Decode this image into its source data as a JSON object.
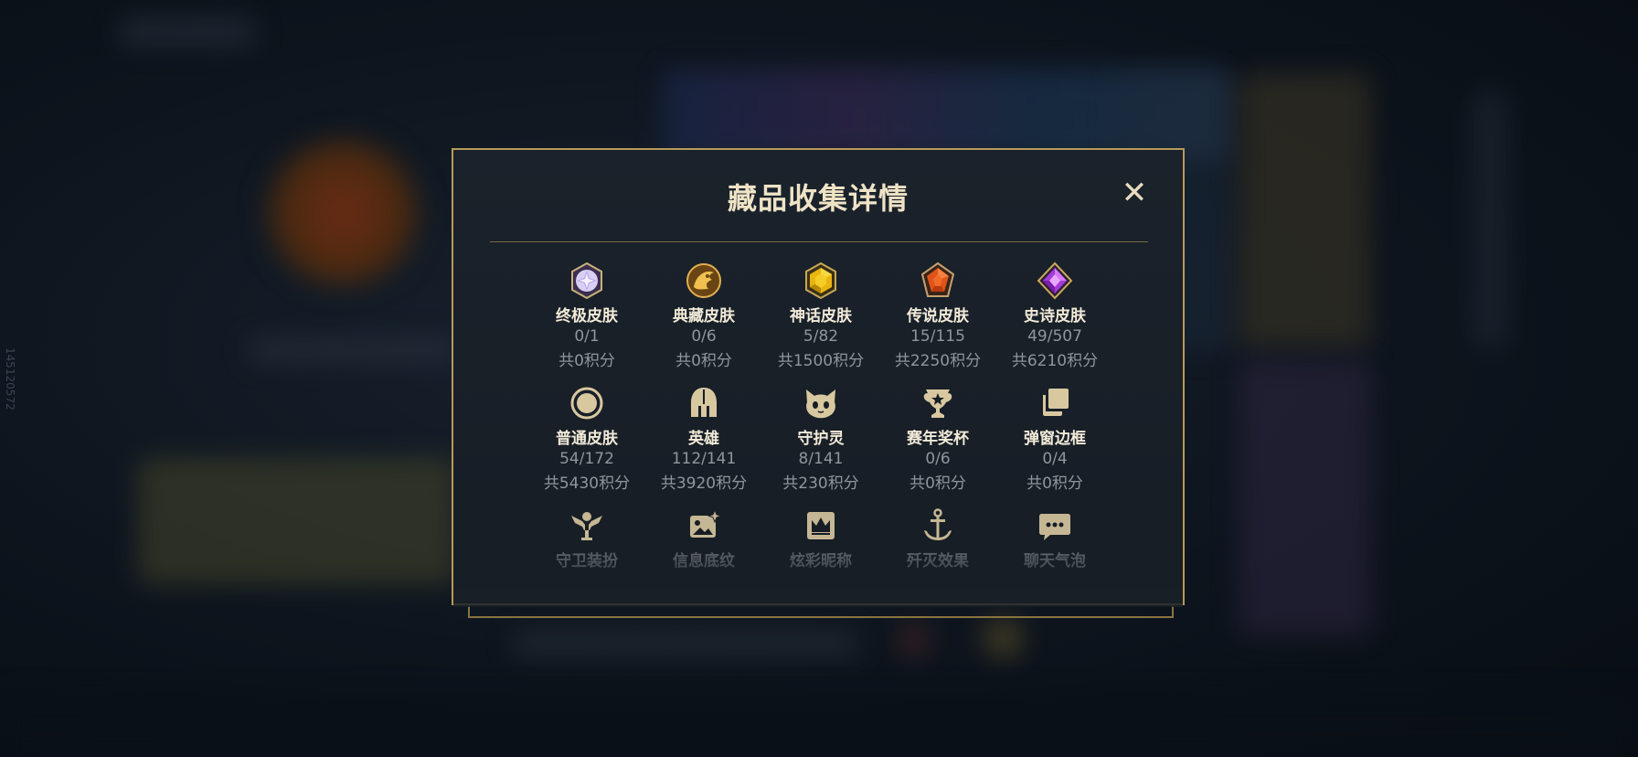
{
  "background": {
    "vertical_id": "145120572"
  },
  "modal": {
    "title": "藏品收集详情",
    "close_glyph": "✕",
    "accent_color": "#b89a5a"
  },
  "items": [
    {
      "label": "终极皮肤",
      "count": "0/1",
      "points": "共0积分",
      "icon": "ultimate-skin-gem-icon"
    },
    {
      "label": "典藏皮肤",
      "count": "0/6",
      "points": "共0积分",
      "icon": "collection-skin-dragon-icon"
    },
    {
      "label": "神话皮肤",
      "count": "5/82",
      "points": "共1500积分",
      "icon": "mythic-skin-gem-icon"
    },
    {
      "label": "传说皮肤",
      "count": "15/115",
      "points": "共2250积分",
      "icon": "legendary-skin-gem-icon"
    },
    {
      "label": "史诗皮肤",
      "count": "49/507",
      "points": "共6210积分",
      "icon": "epic-skin-gem-icon"
    },
    {
      "label": "普通皮肤",
      "count": "54/172",
      "points": "共5430积分",
      "icon": "normal-skin-circle-icon"
    },
    {
      "label": "英雄",
      "count": "112/141",
      "points": "共3920积分",
      "icon": "champion-helmet-icon"
    },
    {
      "label": "守护灵",
      "count": "8/141",
      "points": "共230积分",
      "icon": "guardian-spirit-icon"
    },
    {
      "label": "赛年奖杯",
      "count": "0/6",
      "points": "共0积分",
      "icon": "season-trophy-icon"
    },
    {
      "label": "弹窗边框",
      "count": "0/4",
      "points": "共0积分",
      "icon": "popup-frame-icon"
    },
    {
      "label": "守卫装扮",
      "icon": "ward-skin-icon"
    },
    {
      "label": "信息底纹",
      "icon": "info-background-icon"
    },
    {
      "label": "炫彩昵称",
      "icon": "colorful-nickname-icon"
    },
    {
      "label": "歼灭效果",
      "icon": "kill-effect-icon"
    },
    {
      "label": "聊天气泡",
      "icon": "chat-bubble-icon"
    }
  ]
}
